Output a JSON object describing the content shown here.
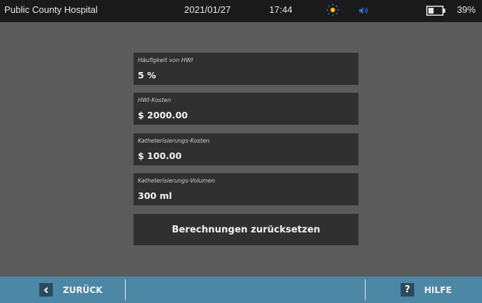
{
  "status_bar": {
    "hospital": "Public County Hospital",
    "date": "2021/01/27",
    "time": "17:44",
    "battery_percent": "39%",
    "brightness_icon": "sun-icon",
    "volume_icon": "speaker-icon",
    "battery_icon": "battery-icon",
    "battery_level": 0.39
  },
  "fields": [
    {
      "label": "Häufigkeit von HWI",
      "value": "5 %"
    },
    {
      "label": "HWI-Kosten",
      "value": "$ 2000.00"
    },
    {
      "label": "Katheterisierungs-Kosten",
      "value": "$ 100.00"
    },
    {
      "label": "Katheterisierungs-Volumen",
      "value": "300 ml"
    }
  ],
  "reset_button": {
    "label": "Berechnungen zurücksetzen"
  },
  "bottom_bar": {
    "back_label": "ZURÜCK",
    "back_icon": "chevron-left-icon",
    "help_label": "HILFE",
    "help_icon": "question-icon",
    "help_glyph": "?"
  },
  "colors": {
    "background": "#5b5b5b",
    "status_bar": "#1a1a1a",
    "field_background": "#303030",
    "bottom_bar": "#4d87a6",
    "accent_yellow": "#f2c200",
    "accent_blue": "#2f6fd6"
  }
}
